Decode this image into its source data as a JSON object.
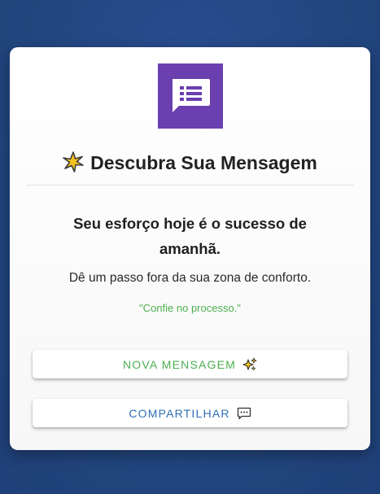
{
  "card": {
    "logo_icon": "message-list-icon",
    "title_icon": "sparkle-star-icon",
    "title": "Descubra Sua Mensagem",
    "headline": "Seu esforço hoje é o sucesso de amanhã.",
    "subtext": "Dê um passo fora da sua zona de conforto.",
    "quote": "\"Confie no processo.\""
  },
  "buttons": {
    "new_message": {
      "label": "NOVA MENSAGEM",
      "icon": "sparkle-icon",
      "color": "#4caf50"
    },
    "share": {
      "label": "COMPARTILHAR",
      "icon": "speech-bubble-icon",
      "color": "#2f6fb3"
    }
  },
  "colors": {
    "background": "#22467f",
    "logo": "#6b3fb0",
    "quote": "#4caf50"
  }
}
